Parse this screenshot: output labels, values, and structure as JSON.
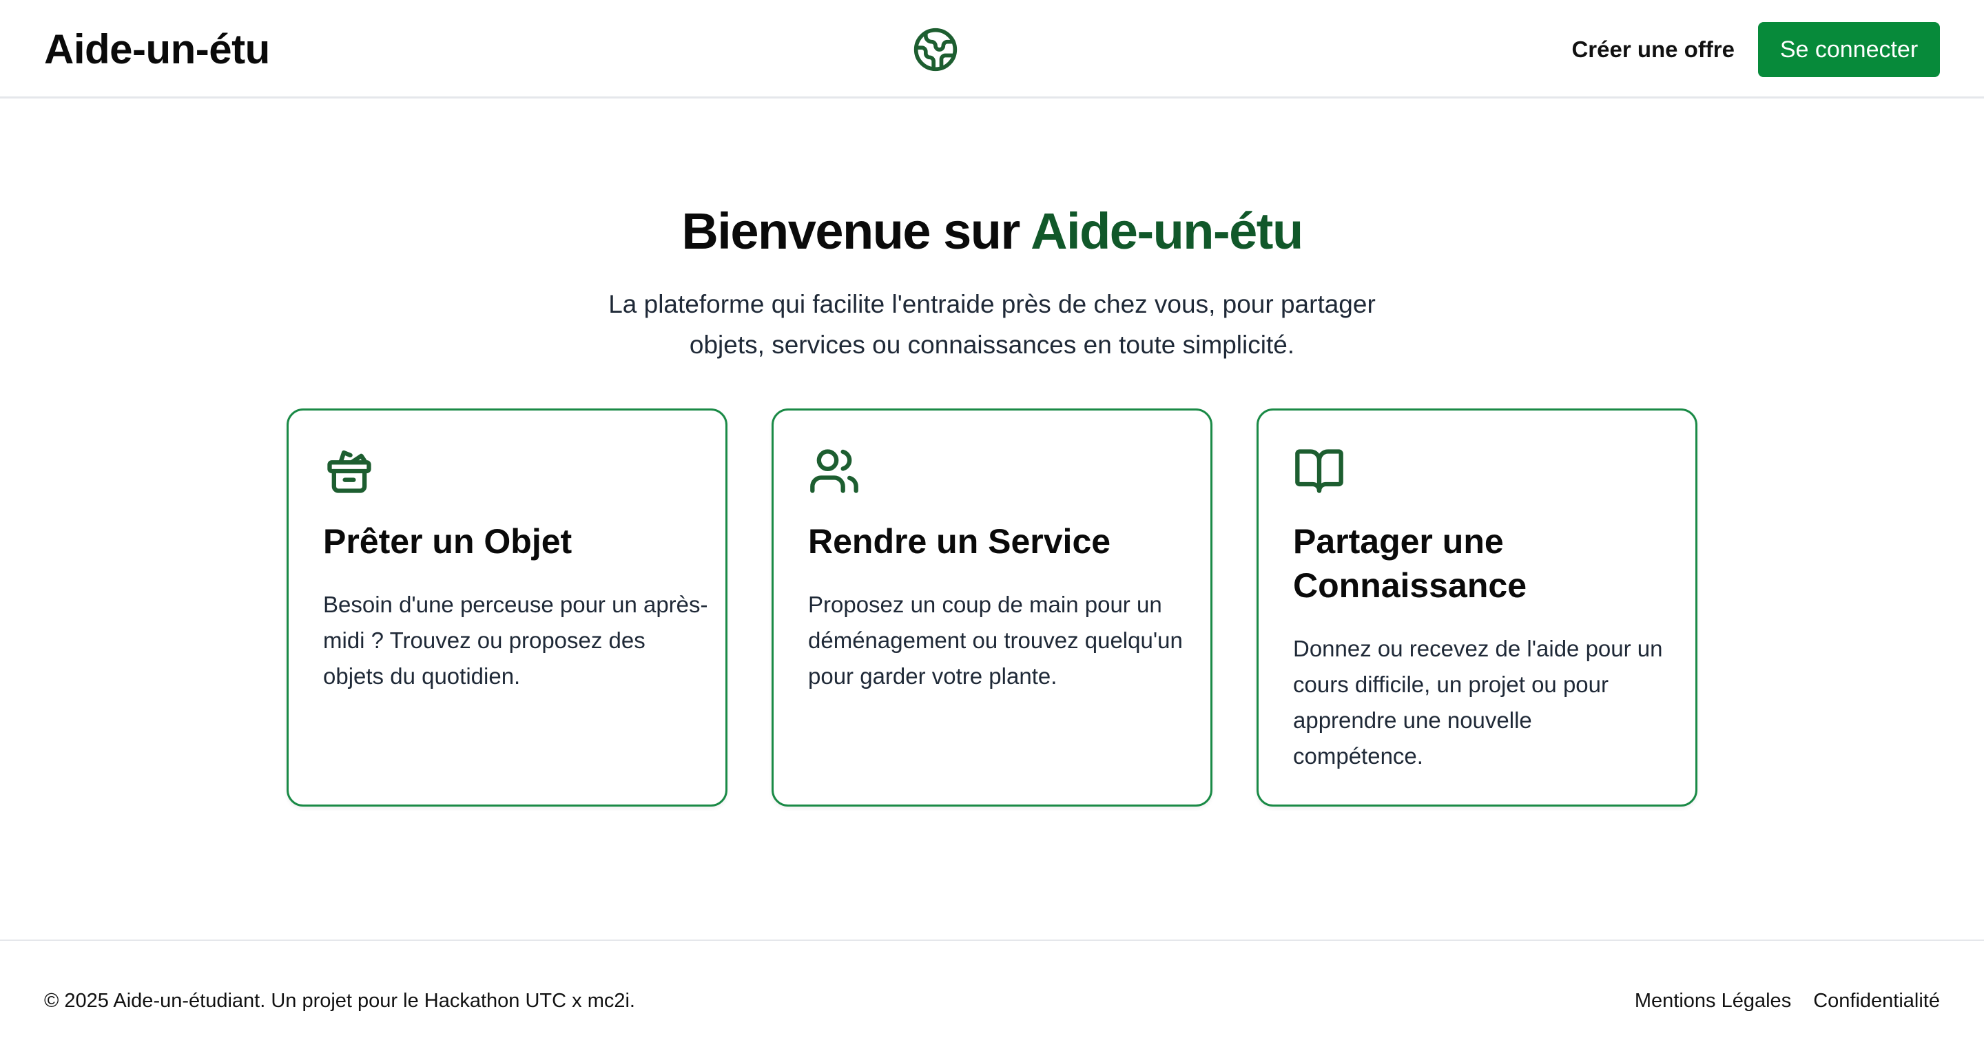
{
  "header": {
    "logo": "Aide-un-étu",
    "logo_icon": "globe-icon",
    "create_offer_label": "Créer une offre",
    "login_label": "Se connecter"
  },
  "hero": {
    "title_prefix": "Bienvenue sur ",
    "title_accent": "Aide-un-étu",
    "subtitle": "La plateforme qui facilite l'entraide près de chez vous, pour partager objets, services ou connaissances en toute simplicité."
  },
  "cards": [
    {
      "icon": "package-icon",
      "title": "Prêter un Objet",
      "description": "Besoin d'une perceuse pour un après-midi ? Trouvez ou proposez des objets du quotidien."
    },
    {
      "icon": "users-icon",
      "title": "Rendre un Service",
      "description": "Proposez un coup de main pour un déménagement ou trouvez quelqu'un pour garder votre plante."
    },
    {
      "icon": "book-open-icon",
      "title": "Partager une Connaissance",
      "description": "Donnez ou recevez de l'aide pour un cours difficile, un projet ou pour apprendre une nouvelle compétence."
    }
  ],
  "footer": {
    "copyright": "© 2025 Aide-un-étudiant. Un projet pour le Hackathon UTC x mc2i.",
    "links": [
      "Mentions Légales",
      "Confidentialité"
    ]
  },
  "colors": {
    "primary_button": "#078a3a",
    "accent_text": "#11582a",
    "card_border": "#1a8a46",
    "icon": "#1d5e30"
  }
}
